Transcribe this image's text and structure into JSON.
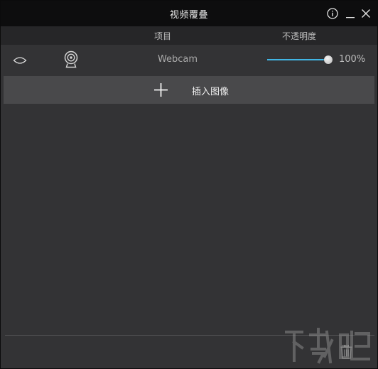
{
  "window": {
    "title": "视频覆叠"
  },
  "columns": {
    "item": "项目",
    "opacity": "不透明度"
  },
  "layers": [
    {
      "name": "Webcam",
      "visible": true,
      "icon": "webcam-icon",
      "opacity_percent": 100,
      "opacity_label": "100%"
    }
  ],
  "insert_button": {
    "label": "插入图像",
    "icon": "plus-icon"
  },
  "icons": {
    "info": "info-icon",
    "minimize": "minimize-icon",
    "close": "close-icon",
    "visibility": "eye-icon",
    "delete": "trash-icon"
  },
  "colors": {
    "titlebar": "#0d0d0e",
    "header": "#262628",
    "panel": "#333335",
    "insert_row": "#49494b",
    "slider_accent": "#41b5e4"
  }
}
